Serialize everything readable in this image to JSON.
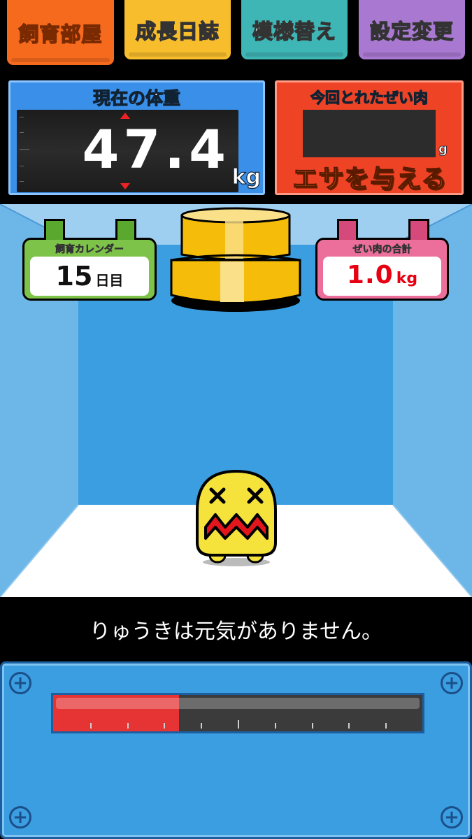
{
  "tabs": {
    "feed_room": "飼育部屋",
    "growth_diary": "成長日誌",
    "pattern_change": "模様替え",
    "settings": "設定変更"
  },
  "weight": {
    "title": "現在の体重",
    "value": "47.4",
    "unit": "kg"
  },
  "meat": {
    "title": "今回とれたぜい肉",
    "value": "",
    "unit": "g",
    "feed_button": "エサを与える"
  },
  "calendar": {
    "title": "飼育カレンダー",
    "day": "15",
    "day_unit": "日目"
  },
  "total_fat": {
    "title": "ぜい肉の合計",
    "value": "1.0",
    "unit": "kg"
  },
  "message": "りゅうきは元気がありません。",
  "gauge": {
    "level": 0.34,
    "fill_color": "#e63434"
  },
  "colors": {
    "room_back": "#3b9ee0",
    "room_side": "#6cb6e8",
    "floor": "#ffffff",
    "character": "#f5e33b"
  },
  "icons": {
    "screws": "plus-screw-icon",
    "weight": "weight-scale-icon"
  }
}
